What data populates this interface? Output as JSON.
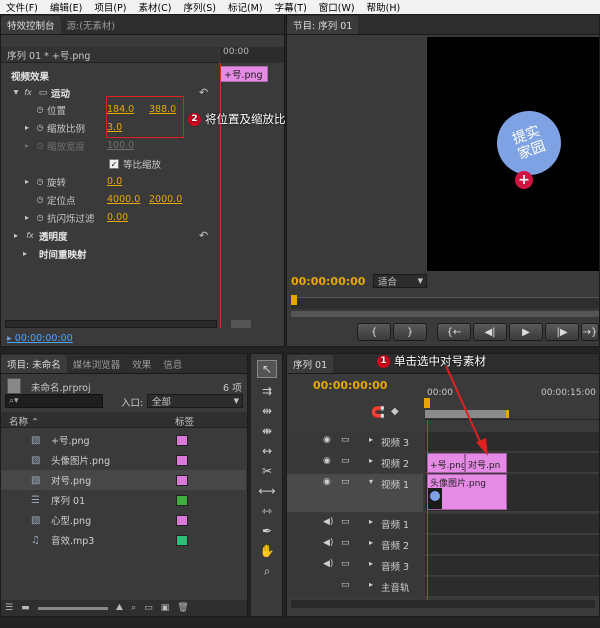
{
  "menu": [
    "文件(F)",
    "编辑(E)",
    "项目(P)",
    "素材(C)",
    "序列(S)",
    "标记(M)",
    "字幕(T)",
    "窗口(W)",
    "帮助(H)"
  ],
  "effect_controls": {
    "tab_active": "特效控制台",
    "tab_inactive": "源:(无素材)",
    "clip_title": "序列 01 * +号.png",
    "ruler_time": "00:00",
    "clip_bar_label": "+号.png",
    "section_video_effects": "视频效果",
    "motion": "运动",
    "position_label": "位置",
    "position_x": "184.0",
    "position_y": "388.0",
    "scale_label": "缩放比例",
    "scale_value": "3.0",
    "scale_width_label": "缩放宽度",
    "scale_width_value": "100.0",
    "uniform_scale_label": "等比缩放",
    "rotation_label": "旋转",
    "rotation_value": "0.0",
    "anchor_label": "定位点",
    "anchor_x": "4000.0",
    "anchor_y": "2000.0",
    "antiflicker_label": "抗闪烁过滤",
    "antiflicker_value": "0.00",
    "opacity_label": "透明度",
    "time_remap_label": "时间重映射",
    "timecode": "00:00:00:00"
  },
  "program_monitor": {
    "tab": "节目: 序列 01",
    "timecode": "00:00:00:00",
    "fit_label": "适合",
    "watermark_line1": "提实",
    "watermark_line2": "家园",
    "transport": [
      "{",
      "}",
      "{←",
      "◀|",
      "▶",
      "|▶",
      "→}"
    ]
  },
  "project": {
    "tabs": [
      "项目: 未命名",
      "媒体浏览器",
      "效果",
      "信息"
    ],
    "file_name": "未命名.prproj",
    "item_count": "6 项",
    "in_label": "入口:",
    "in_value": "全部",
    "col_name": "名称",
    "col_label": "标签",
    "items": [
      {
        "name": "+号.png",
        "color": "#d97ad9",
        "icon": "image-icon"
      },
      {
        "name": "头像图片.png",
        "color": "#d97ad9",
        "icon": "image-icon"
      },
      {
        "name": "对号.png",
        "color": "#d97ad9",
        "icon": "image-icon"
      },
      {
        "name": "序列 01",
        "color": "#3fae3f",
        "icon": "sequence-icon"
      },
      {
        "name": "心型.png",
        "color": "#d97ad9",
        "icon": "image-icon"
      },
      {
        "name": "音效.mp3",
        "color": "#2bc07a",
        "icon": "audio-icon"
      }
    ]
  },
  "timeline": {
    "tab": "序列 01",
    "timecode": "00:00:00:00",
    "ruler_start": "00:00",
    "ruler_mid": "00:00:15:00",
    "tracks": [
      "视频 3",
      "视频 2",
      "视频 1",
      "音频 1",
      "音频 2",
      "音频 3",
      "主音轨"
    ],
    "clips": {
      "v2_a": "+号.png",
      "v2_b": "对号.pn",
      "v1": "头像图片.png"
    }
  },
  "annotations": {
    "step1": {
      "num": "1",
      "text": "单击选中对号素材"
    },
    "step2": {
      "num": "2",
      "text": "将位置及缩放比例数值设置与+号素材一致"
    }
  },
  "colors": {
    "accent": "#e6a800",
    "clip_pink": "#e58be5",
    "annotation_red": "#d0021b"
  }
}
